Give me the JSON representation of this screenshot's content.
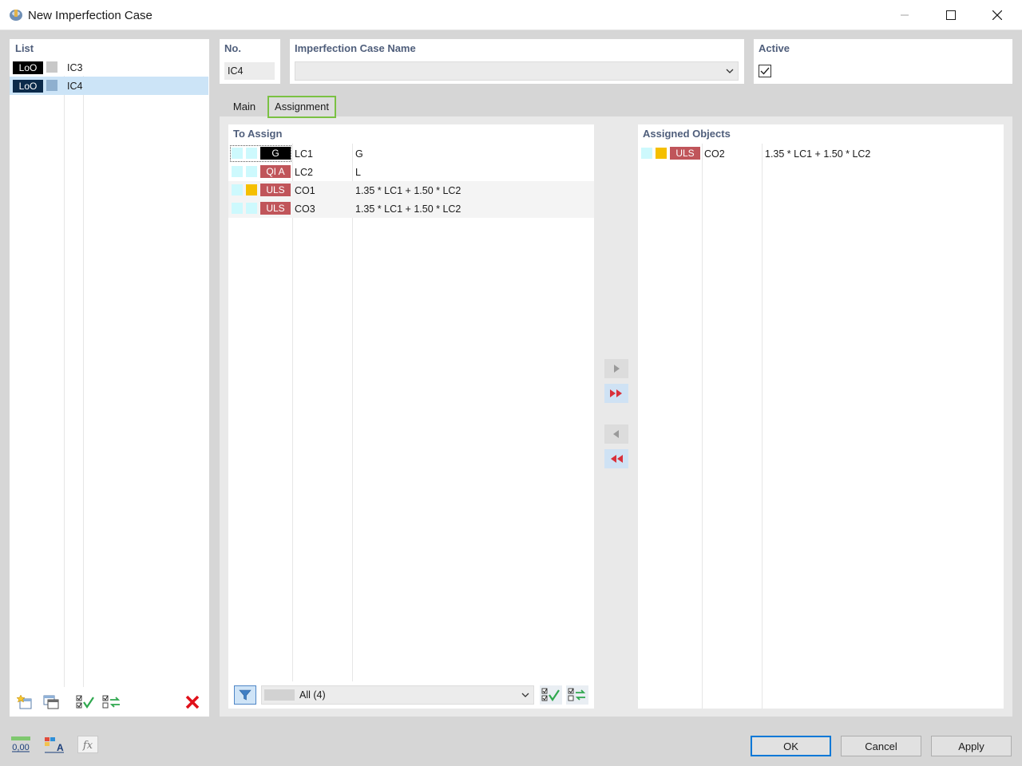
{
  "window": {
    "title": "New Imperfection Case"
  },
  "list": {
    "title": "List",
    "items": [
      {
        "tag": "LoO",
        "swatch": "#c8c8c8",
        "name": "IC3",
        "selected": false
      },
      {
        "tag": "LoO",
        "swatch": "#8fb0cf",
        "name": "IC4",
        "selected": true
      }
    ],
    "tools": [
      "new-item-icon",
      "copy-item-icon",
      "check-all-icon",
      "toggle-check-icon",
      "delete-icon"
    ]
  },
  "header": {
    "no_label": "No.",
    "no_value": "IC4",
    "name_label": "Imperfection Case Name",
    "name_value": "",
    "active_label": "Active",
    "active_checked": true
  },
  "tabs": [
    {
      "label": "Main",
      "active": false
    },
    {
      "label": "Assignment",
      "active": true
    }
  ],
  "to_assign": {
    "title": "To Assign",
    "rows": [
      {
        "swatch2": "#cdf9fd",
        "badge": "G",
        "badge_color": "#000000",
        "id": "LC1",
        "desc": "G"
      },
      {
        "swatch2": "#cdf9fd",
        "badge": "QI A",
        "badge_color": "#c0555a",
        "id": "LC2",
        "desc": "L"
      },
      {
        "swatch2": "#f5bf00",
        "badge": "ULS",
        "badge_color": "#c0555a",
        "id": "CO1",
        "desc": "1.35 * LC1 + 1.50 * LC2"
      },
      {
        "swatch2": "#cdf9fd",
        "badge": "ULS",
        "badge_color": "#c0555a",
        "id": "CO3",
        "desc": "1.35 * LC1 + 1.50 * LC2"
      }
    ],
    "filter_value": "All (4)"
  },
  "assigned": {
    "title": "Assigned Objects",
    "rows": [
      {
        "swatch2": "#f5bf00",
        "badge": "ULS",
        "badge_color": "#c0555a",
        "id": "CO2",
        "desc": "1.35 * LC1 + 1.50 * LC2"
      }
    ]
  },
  "buttons": {
    "ok": "OK",
    "cancel": "Cancel",
    "apply": "Apply"
  },
  "bottom_tools": [
    "units-icon",
    "text-format-icon",
    "formula-icon"
  ],
  "bottom_units_label": "0,00"
}
